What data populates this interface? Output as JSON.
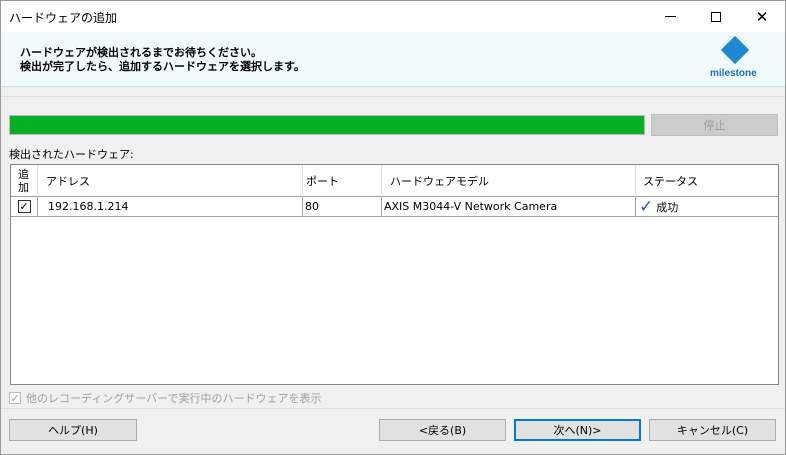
{
  "window": {
    "title": "ハードウェアの追加"
  },
  "header": {
    "line1": "ハードウェアが検出されるまでお待ちください。",
    "line2": "検出が完了したら、追加するハードウェアを選択します。",
    "logo_text": "milestone"
  },
  "progress": {
    "value_percent": 100,
    "stop_label": "停止"
  },
  "detected_label": "検出されたハードウェア:",
  "table": {
    "columns": [
      "追加",
      "アドレス",
      "ポート",
      "ハードウェアモデル",
      "ステータス"
    ],
    "rows": [
      {
        "checked": true,
        "address": "192.168.1.214",
        "port": "80",
        "model": "AXIS M3044-V Network Camera",
        "status": "成功",
        "status_icon": "checkmark-icon"
      }
    ]
  },
  "show_other": {
    "label": "他のレコーディングサーバーで実行中のハードウェアを表示",
    "checked": true,
    "disabled": true
  },
  "buttons": {
    "help": "ヘルプ(H)",
    "back": "<戻る(B)",
    "next": "次へ(N)>",
    "cancel": "キャンセル(C)"
  },
  "colors": {
    "progress": "#06b025",
    "header_bg": "#f1fafd",
    "logo": "#1a8ad3",
    "check": "#2a5aa0"
  }
}
